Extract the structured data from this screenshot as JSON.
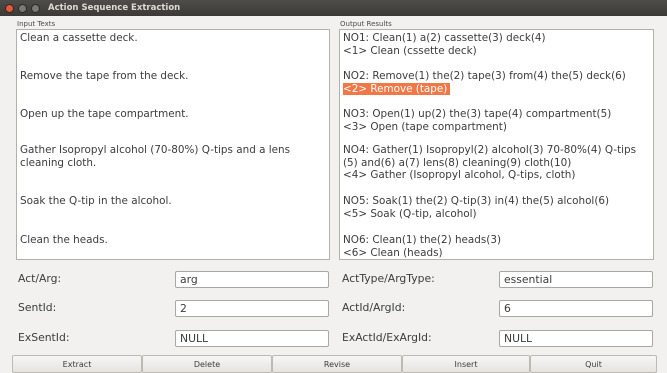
{
  "window": {
    "title": "Action Sequence Extraction"
  },
  "input_panel": {
    "label": "Input Texts",
    "lines": [
      "Clean a cassette deck.",
      "Remove the tape from the deck.",
      "Open up the tape compartment.",
      "Gather Isopropyl alcohol (70-80%) Q-tips and a lens cleaning cloth.",
      "Soak the Q-tip in the alcohol.",
      "Clean the heads."
    ]
  },
  "output_panel": {
    "label": "Output Results",
    "entries": [
      {
        "tokens": "NO1: Clean(1) a(2) cassette(3) deck(4)",
        "action": "<1> Clean (cssette deck)"
      },
      {
        "tokens": "NO2: Remove(1) the(2) tape(3) from(4) the(5) deck(6)",
        "action": "<2> Remove (tape)"
      },
      {
        "tokens": "NO3: Open(1) up(2) the(3) tape(4) compartment(5)",
        "action": "<3> Open (tape compartment)"
      },
      {
        "tokens": "NO4: Gather(1) Isopropyl(2) alcohol(3) 70-80%(4) Q-tips (5) and(6) a(7) lens(8) cleaning(9) cloth(10)",
        "action": "<4> Gather (Isopropyl alcohol, Q-tips, cloth)"
      },
      {
        "tokens": "NO5: Soak(1) the(2) Q-tip(3) in(4) the(5) alcohol(6)",
        "action": "<5> Soak (Q-tip, alcohol)"
      },
      {
        "tokens": "NO6: Clean(1) the(2) heads(3)",
        "action": "<6> Clean (heads)"
      }
    ]
  },
  "form": {
    "act_arg": {
      "label": "Act/Arg:",
      "value": "arg"
    },
    "act_type": {
      "label": "ActType/ArgType:",
      "value": "essential"
    },
    "sent_id": {
      "label": "SentId:",
      "value": "2"
    },
    "act_id": {
      "label": "ActId/ArgId:",
      "value": "6"
    },
    "ex_sent_id": {
      "label": "ExSentId:",
      "value": "NULL"
    },
    "ex_act_id": {
      "label": "ExActId/ExArgId:",
      "value": "NULL"
    }
  },
  "buttons": {
    "extract": "Extract",
    "delete": "Delete",
    "revise": "Revise",
    "insert": "Insert",
    "quit": "Quit"
  },
  "colors": {
    "highlight": "#f07746",
    "titlebar": "#3b3a37"
  }
}
